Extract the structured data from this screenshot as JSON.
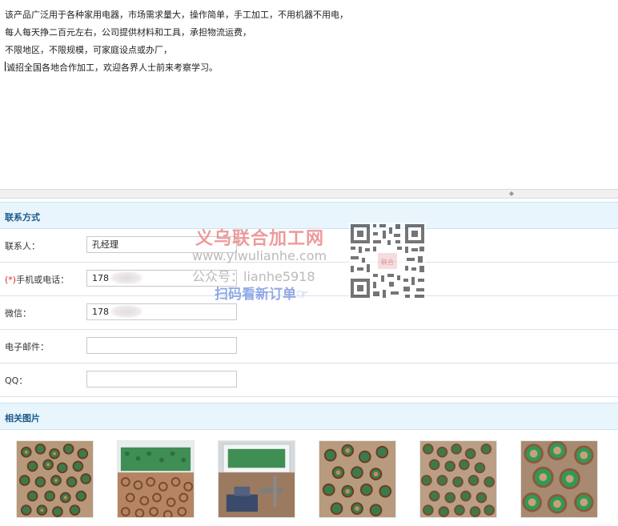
{
  "description": {
    "lines": [
      "该产品广泛用于各种家用电器，市场需求量大，操作简单，手工加工，不用机器不用电，",
      "每人每天挣二百元左右，公司提供材料和工具，承担物流运费，",
      "不限地区，不限规模，可家庭设点或办厂，",
      "诚招全国各地合作加工，欢迎各界人士前来考察学习。"
    ]
  },
  "contact": {
    "section_title": "联系方式",
    "fields": [
      {
        "label": "联系人：",
        "value": "孔经理"
      },
      {
        "label_required": "(*)",
        "label": "手机或电话：",
        "value": "178"
      },
      {
        "label": "微信：",
        "value": "178"
      },
      {
        "label": "电子邮件：",
        "value": ""
      },
      {
        "label": "QQ：",
        "value": ""
      }
    ]
  },
  "watermark": {
    "title": "义乌联合加工网",
    "url": "www.yiwulianhe.com",
    "gzh": "公众号：lianhe5918",
    "scan": "扫码看新订单☞",
    "qr_label": "联合"
  },
  "photos_section": {
    "title": "相关图片",
    "photos": [
      {
        "alt": "copper-green-rings-pile-1"
      },
      {
        "alt": "rings-in-tray"
      },
      {
        "alt": "rings-with-vise-tool"
      },
      {
        "alt": "copper-green-rings-pile-2"
      },
      {
        "alt": "copper-green-rings-pile-3"
      },
      {
        "alt": "copper-green-rings-closeup"
      }
    ]
  },
  "colors": {
    "section_bg": "#e8f5fc",
    "section_title": "#1d5a8a",
    "required": "#d8262a"
  }
}
